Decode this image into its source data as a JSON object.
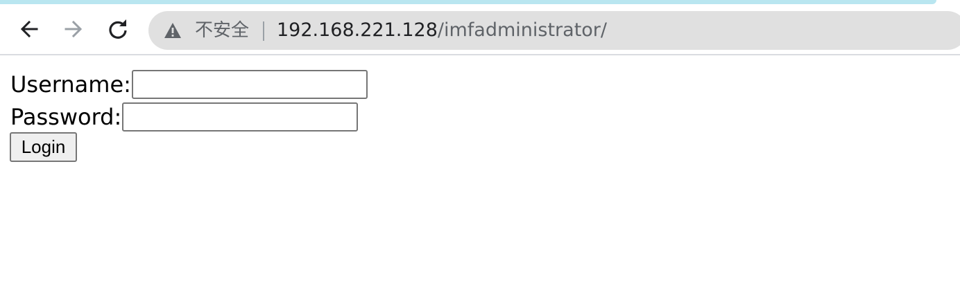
{
  "browser": {
    "security_label": "不安全",
    "url_host": "192.168.221.128",
    "url_path": "/imfadministrator/",
    "icons": {
      "back": "back-arrow-icon",
      "forward": "forward-arrow-icon",
      "reload": "reload-icon",
      "security": "warning-triangle-icon"
    },
    "colors": {
      "tab_strip": "#b9e6f0",
      "omnibox": "#e0e0e0",
      "forward_disabled": "#9aa0a6"
    }
  },
  "form": {
    "username_label": "Username:",
    "username_value": "",
    "password_label": "Password:",
    "password_value": "",
    "login_label": "Login"
  }
}
